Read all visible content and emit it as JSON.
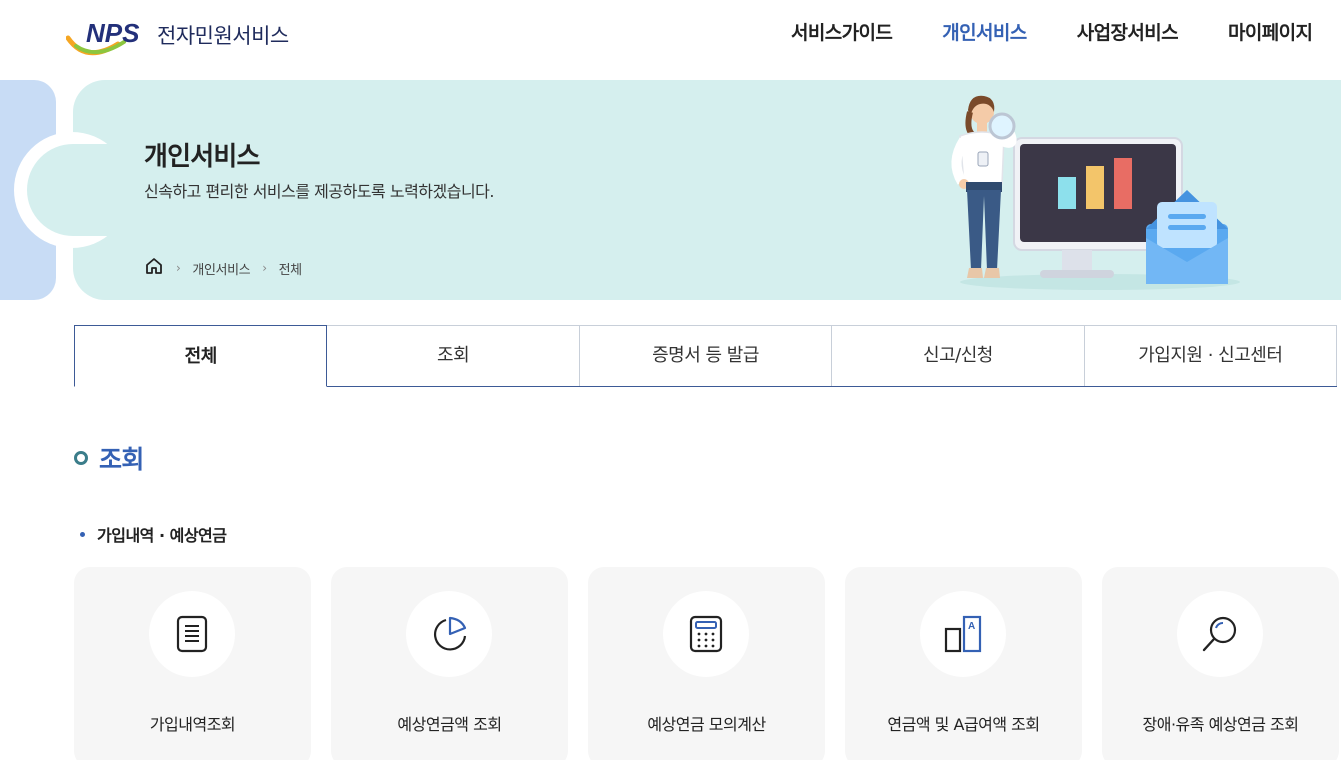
{
  "header": {
    "logo_mark": "NPS",
    "logo_text": "전자민원서비스",
    "nav": [
      {
        "label": "서비스가이드",
        "active": false
      },
      {
        "label": "개인서비스",
        "active": true
      },
      {
        "label": "사업장서비스",
        "active": false
      },
      {
        "label": "마이페이지",
        "active": false
      }
    ]
  },
  "banner": {
    "title": "개인서비스",
    "description": "신속하고 편리한 서비스를 제공하도록 노력하겠습니다.",
    "breadcrumb": [
      "개인서비스",
      "전체"
    ]
  },
  "tabs": [
    {
      "label": "전체",
      "active": true
    },
    {
      "label": "조회",
      "active": false
    },
    {
      "label": "증명서 등 발급",
      "active": false
    },
    {
      "label": "신고/신청",
      "active": false
    },
    {
      "label": "가입지원 · 신고센터",
      "active": false
    }
  ],
  "section": {
    "title": "조회",
    "subtitle": "가입내역 · 예상연금",
    "cards": [
      {
        "label": "가입내역조회",
        "icon": "document-list-icon"
      },
      {
        "label": "예상연금액 조회",
        "icon": "pie-chart-icon"
      },
      {
        "label": "예상연금 모의계산",
        "icon": "calculator-icon"
      },
      {
        "label": "연금액 및 A급여액 조회",
        "icon": "bar-compare-icon"
      },
      {
        "label": "장애·유족 예상연금 조회",
        "icon": "magnifier-icon"
      }
    ]
  },
  "colors": {
    "accent": "#3461b4",
    "banner_bg": "#d5efee",
    "side_deco": "#c8dcf5",
    "card_bg": "#f6f6f6",
    "tab_border": "#3d5a96"
  }
}
